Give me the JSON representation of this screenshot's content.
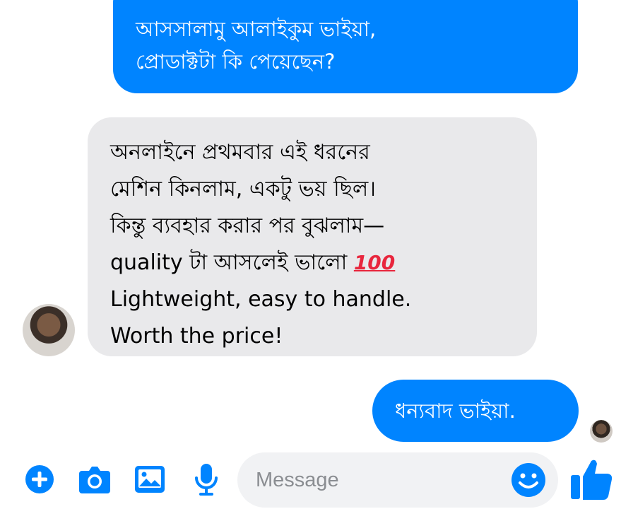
{
  "colors": {
    "accent": "#0084ff",
    "incoming_bubble": "#e9e9eb",
    "input_background": "#f1f2f4"
  },
  "conversation": {
    "messages": [
      {
        "sender": "me",
        "lines": [
          "আসসালামু আলাইকুম ভাইয়া,",
          "প্রোডাক্টটা কি পেয়েছেন?"
        ]
      },
      {
        "sender": "them",
        "lines": [
          "অনলাইনে প্রথমবার এই ধরনের",
          "মেশিন কিনলাম, একটু ভয় ছিল।",
          "কিন্তু ব্যবহার করার পর বুঝলাম—",
          "quality টা আসলেই ভালো",
          "Lightweight, easy to handle.",
          "Worth the price!"
        ],
        "emoji": "100",
        "emoji_icon": "hundred-points-emoji"
      },
      {
        "sender": "me",
        "lines": [
          "ধন্যবাদ ভাইয়া."
        ]
      }
    ]
  },
  "composer": {
    "placeholder": "Message",
    "icons": [
      "plus-icon",
      "camera-icon",
      "image-icon",
      "mic-icon",
      "smiley-icon",
      "thumbs-up-icon"
    ]
  }
}
